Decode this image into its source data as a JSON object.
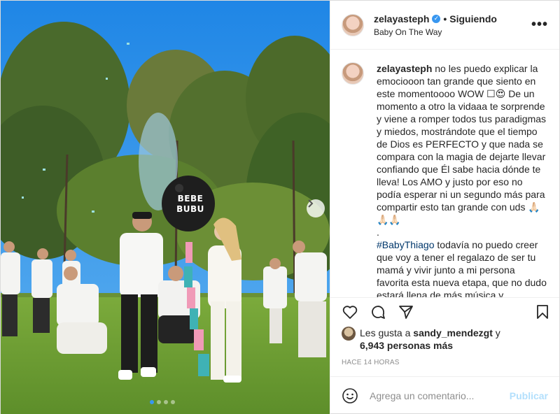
{
  "header": {
    "username": "zelayasteph",
    "follow_status": "Siguiendo",
    "bullet": "•",
    "location": "Baby On The Way",
    "more": "•••"
  },
  "photo": {
    "balloon_text_1": "BEBE",
    "balloon_text_2": "BUBU",
    "carousel_count": 4,
    "carousel_active": 0
  },
  "caption": {
    "username": "zelayasteph",
    "text1": "no les puedo explicar la emociooon tan grande que siento en este momentoooo WOW ☐😍 De un momento a otro la vidaaa te sorprende y viene a romper todos tus paradigmas y miedos, mostrándote que el tiempo de Dios es PERFECTO y que nada se compara con la magia de dejarte llevar confiando que Él sabe hacia dónde te lleva! Los AMO y justo por eso no podía esperar ni un segundo más para compartir esto tan grande con uds 🙏🏻🙏🏻🙏🏻",
    "separator": ".",
    "hashtag": "#BabyThiago",
    "text2": " todavía no puedo creer que voy a tener el regalazo de ser tu mamá y vivir junto a mi persona favorita esta nueva etapa, que no dudo estará llena de más música y"
  },
  "likes": {
    "prefix": "Les gusta a ",
    "user": "sandy_mendezgt",
    "joiner": " y",
    "others": "6,943 personas más"
  },
  "timestamp": "HACE 14 HORAS",
  "comment": {
    "placeholder": "Agrega un comentario...",
    "publish": "Publicar"
  },
  "colors": {
    "verified": "#3897f0",
    "publish": "#b2dffc",
    "hashtag": "#00376b"
  },
  "icons": [
    "heart-icon",
    "comment-icon",
    "share-icon",
    "bookmark-icon",
    "emoji-icon",
    "chevron-right-icon",
    "verified-icon"
  ]
}
